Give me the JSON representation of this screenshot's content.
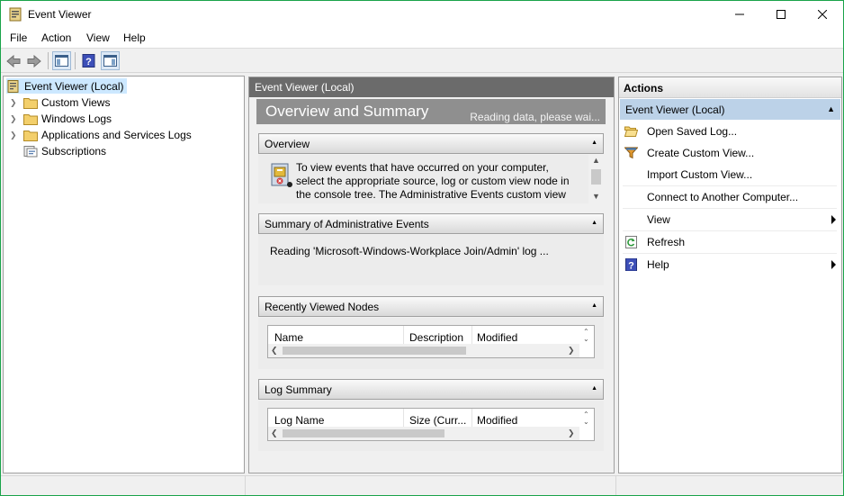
{
  "window": {
    "title": "Event Viewer"
  },
  "menu": [
    "File",
    "Action",
    "View",
    "Help"
  ],
  "tree": [
    {
      "label": "Event Viewer (Local)",
      "selected": true
    },
    {
      "label": "Custom Views"
    },
    {
      "label": "Windows Logs"
    },
    {
      "label": "Applications and Services Logs"
    },
    {
      "label": "Subscriptions"
    }
  ],
  "center": {
    "header": "Event Viewer (Local)",
    "banner_title": "Overview and Summary",
    "banner_status": "Reading data, please wai...",
    "overview": {
      "title": "Overview",
      "text": "To view events that have occurred on your computer, select the appropriate source, log or custom view node in the console tree. The Administrative Events custom view contains all the administrative events, regardless of source."
    },
    "summary": {
      "title": "Summary of Administrative Events",
      "text": "Reading 'Microsoft-Windows-Workplace Join/Admin' log ..."
    },
    "recent": {
      "title": "Recently Viewed Nodes",
      "columns": [
        "Name",
        "Description",
        "Modified"
      ]
    },
    "logsummary": {
      "title": "Log Summary",
      "columns": [
        "Log Name",
        "Size (Curr...",
        "Modified"
      ]
    }
  },
  "actions": {
    "title": "Actions",
    "group": "Event Viewer (Local)",
    "items": [
      {
        "label": "Open Saved Log...",
        "icon": "folder-open-icon"
      },
      {
        "label": "Create Custom View...",
        "icon": "filter-icon"
      },
      {
        "label": "Import Custom View...",
        "icon": ""
      },
      {
        "label": "Connect to Another Computer...",
        "icon": ""
      },
      {
        "label": "View",
        "icon": "",
        "submenu": true
      },
      {
        "label": "Refresh",
        "icon": "refresh-icon"
      },
      {
        "label": "Help",
        "icon": "help-icon",
        "submenu": true
      }
    ]
  },
  "colors": {
    "window_border": "#1aa34a",
    "selection": "#cce8ff",
    "action_group": "#bcd2e8",
    "center_header": "#6b6b6b",
    "banner": "#8f8f8f"
  }
}
